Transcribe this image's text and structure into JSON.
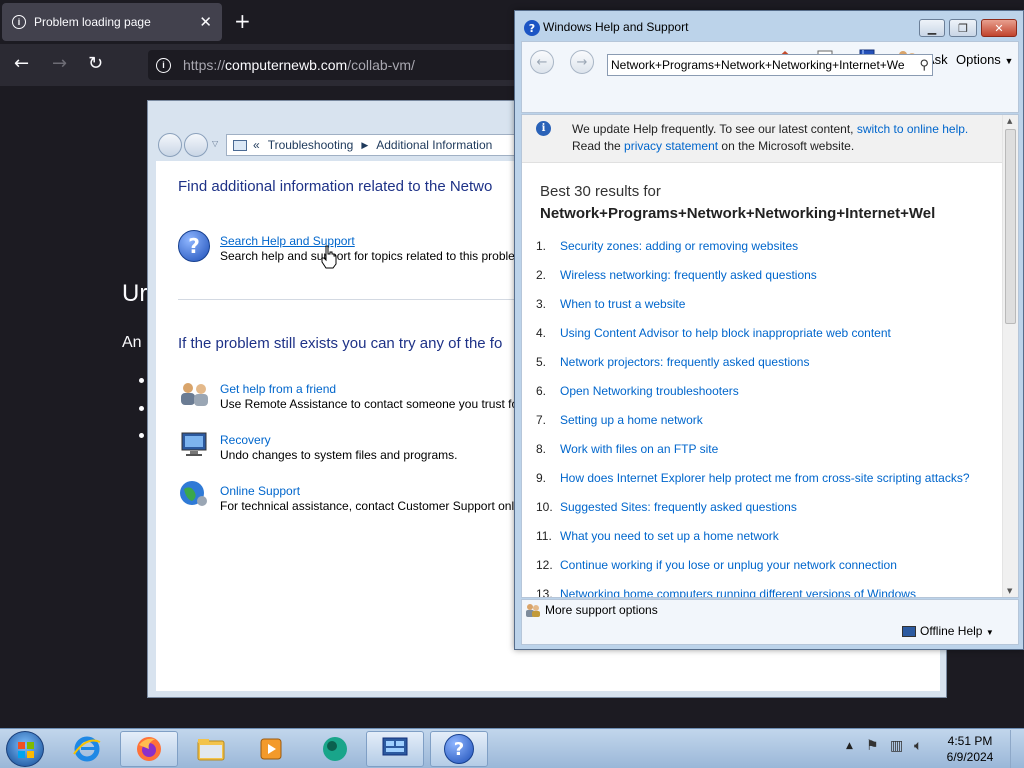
{
  "browser": {
    "tab_title": "Problem loading page",
    "url_host": "computernewb.com",
    "url_prefix": "https://",
    "url_path": "/collab-vm/",
    "bg_heading_partial": "Ur",
    "bg_para_partial": "An"
  },
  "troubleshoot": {
    "breadcrumb": [
      "Troubleshooting",
      "Additional Information"
    ],
    "heading_find": "Find additional information related to the Netwo",
    "search_link": "Search Help and Support",
    "search_desc": "Search help and support for topics related to this proble",
    "heading_still": "If the problem still exists you can try any of the fo",
    "options": [
      {
        "title": "Get help from a friend",
        "desc": "Use Remote Assistance to contact someone you trust fo"
      },
      {
        "title": "Recovery",
        "desc": "Undo changes to system files and programs."
      },
      {
        "title": "Online Support",
        "desc": "For technical assistance, contact Customer Support onli"
      }
    ]
  },
  "help": {
    "window_title": "Windows Help and Support",
    "ask_label": "Ask",
    "options_label": "Options",
    "search_value": "Network+Programs+Network+Networking+Internet+We",
    "notice_pre": "We update Help frequently. To see our latest content, ",
    "notice_link1": "switch to online help.",
    "notice_read": "Read the ",
    "notice_link2": "privacy statement",
    "notice_post": " on the Microsoft website.",
    "results_heading": "Best 30 results for",
    "results_query": "Network+Programs+Network+Networking+Internet+Wel",
    "results": [
      {
        "num": "1.",
        "title": "Security zones: adding or removing websites"
      },
      {
        "num": "2.",
        "title": "Wireless networking: frequently asked questions"
      },
      {
        "num": "3.",
        "title": "When to trust a website"
      },
      {
        "num": "4.",
        "title": "Using Content Advisor to help block inappropriate web content"
      },
      {
        "num": "5.",
        "title": "Network projectors: frequently asked questions"
      },
      {
        "num": "6.",
        "title": "Open Networking troubleshooters"
      },
      {
        "num": "7.",
        "title": "Setting up a home network"
      },
      {
        "num": "8.",
        "title": "Work with files on an FTP site"
      },
      {
        "num": "9.",
        "title": "How does Internet Explorer help protect me from cross-site scripting attacks?"
      },
      {
        "num": "10.",
        "title": "Suggested Sites: frequently asked questions"
      },
      {
        "num": "11.",
        "title": "What you need to set up a home network"
      },
      {
        "num": "12.",
        "title": "Continue working if you lose or unplug your network connection"
      },
      {
        "num": "13.",
        "title": "Networking home computers running different versions of Windows"
      }
    ],
    "more_support": "More support options",
    "offline_help": "Offline Help"
  },
  "taskbar": {
    "time": "4:51 PM",
    "date": "6/9/2024"
  }
}
